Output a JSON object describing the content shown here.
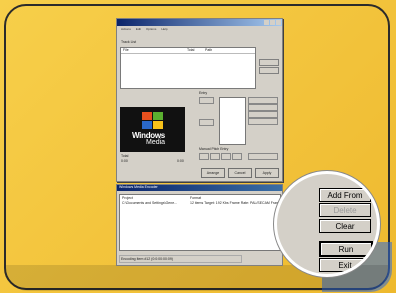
{
  "app": {
    "menus": [
      "Actions",
      "Edit",
      "Options",
      "Help"
    ],
    "tracklist": {
      "group_label": "Track List",
      "columns": [
        "File",
        "Total",
        "Path"
      ]
    },
    "entry_label": "Entry",
    "media": {
      "line1": "Windows",
      "line2": "Media"
    },
    "time_labels": {
      "total": "Total",
      "time": "0:00",
      "time2": "0:00"
    },
    "manual": {
      "label": "Manual Pitch Entry"
    },
    "bottom_buttons": [
      "Arrange",
      "Cancel",
      "Apply"
    ]
  },
  "encoder": {
    "title": "Windows Media Encoder",
    "columns": [
      "Project",
      "Format"
    ],
    "row_project": "C:\\Documents and Settings\\Gene...",
    "row_format": "12 items  Target: 192 Kbs  Frame Rate: PAL/SECAM  Frame...",
    "status": "Encoding Item #12  (0:0:00:00:09)"
  },
  "zoom_panel": {
    "buttons": [
      {
        "label": "Add From",
        "state": "normal"
      },
      {
        "label": "Delete",
        "state": "disabled"
      },
      {
        "label": "Clear",
        "state": "normal"
      },
      {
        "label": "Run",
        "state": "default"
      },
      {
        "label": "Exit",
        "state": "normal"
      }
    ]
  },
  "colors": {
    "background": "#f5c842",
    "window": "#d4d0c8",
    "title_bar": "#0a246a",
    "accent": "#2d6ad8"
  }
}
